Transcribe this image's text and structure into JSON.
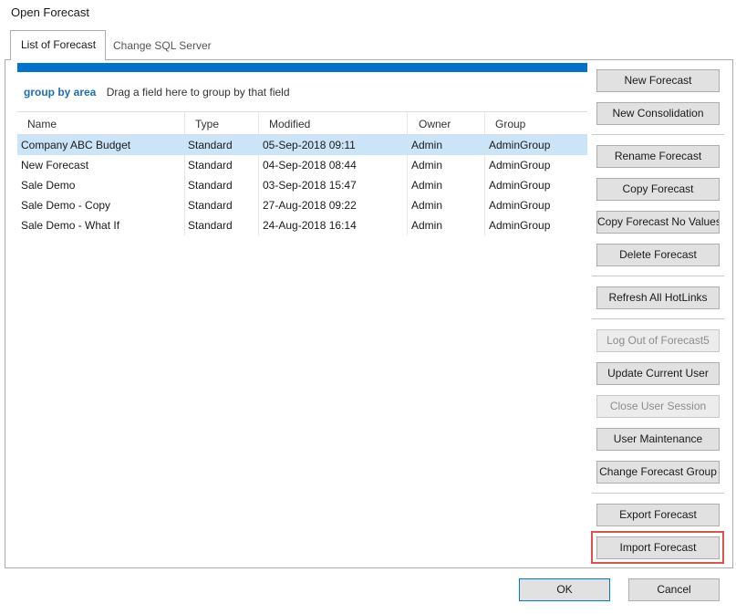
{
  "window": {
    "title": "Open Forecast"
  },
  "tabs": [
    {
      "label": "List of Forecast",
      "active": true
    },
    {
      "label": "Change SQL Server",
      "active": false
    }
  ],
  "grouping": {
    "label": "group by area",
    "hint": "Drag a field here to group by that field"
  },
  "table": {
    "headers": {
      "name": "Name",
      "type": "Type",
      "modified": "Modified",
      "owner": "Owner",
      "group": "Group"
    },
    "rows": [
      {
        "name": "Company ABC Budget",
        "type": "Standard",
        "modified": "05-Sep-2018 09:11",
        "owner": "Admin",
        "group": "AdminGroup",
        "selected": true
      },
      {
        "name": "New Forecast",
        "type": "Standard",
        "modified": "04-Sep-2018 08:44",
        "owner": "Admin",
        "group": "AdminGroup"
      },
      {
        "name": "Sale Demo",
        "type": "Standard",
        "modified": "03-Sep-2018 15:47",
        "owner": "Admin",
        "group": "AdminGroup"
      },
      {
        "name": "Sale Demo - Copy",
        "type": "Standard",
        "modified": "27-Aug-2018 09:22",
        "owner": "Admin",
        "group": "AdminGroup"
      },
      {
        "name": "Sale Demo - What If",
        "type": "Standard",
        "modified": "24-Aug-2018 16:14",
        "owner": "Admin",
        "group": "AdminGroup"
      }
    ]
  },
  "actions": {
    "new_forecast": "New Forecast",
    "new_consolidation": "New Consolidation",
    "rename_forecast": "Rename Forecast",
    "copy_forecast": "Copy Forecast",
    "copy_forecast_no_values": "Copy Forecast No Values",
    "delete_forecast": "Delete Forecast",
    "refresh_all_hotlinks": "Refresh All HotLinks",
    "log_out": "Log Out of Forecast5",
    "update_current_user": "Update Current User",
    "close_user_session": "Close User Session",
    "user_maintenance": "User Maintenance",
    "change_forecast_group": "Change Forecast Group",
    "export_forecast": "Export Forecast",
    "import_forecast": "Import Forecast"
  },
  "footer": {
    "ok": "OK",
    "cancel": "Cancel"
  },
  "colors": {
    "accent": "#0073cf",
    "selection": "#cce4f7",
    "highlight": "#d9534f"
  }
}
